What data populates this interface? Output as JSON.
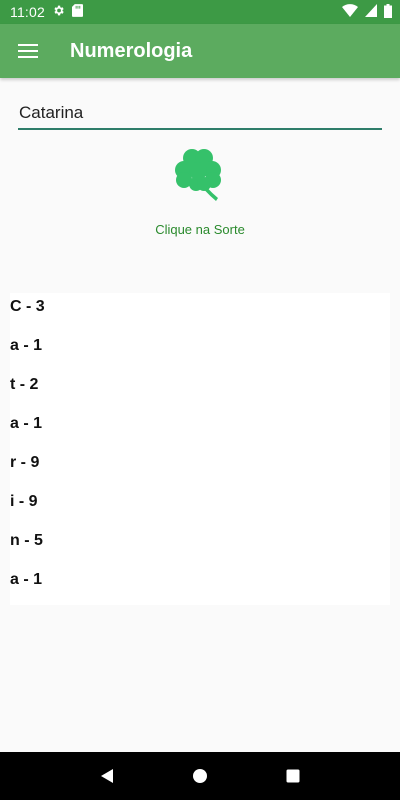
{
  "status_bar": {
    "time": "11:02",
    "icons": [
      "gear-icon",
      "sd-card-icon",
      "wifi-icon",
      "signal-icon",
      "battery-icon"
    ]
  },
  "app_bar": {
    "title": "Numerologia",
    "menu_icon": "hamburger-menu-icon"
  },
  "name_input": {
    "value": "Catarina"
  },
  "luck": {
    "icon": "clover-icon",
    "label": "Clique na Sorte"
  },
  "results": [
    "C - 3",
    "a - 1",
    "t - 2",
    "a - 1",
    "r - 9",
    "i - 9",
    "n - 5",
    "a - 1"
  ],
  "nav_bar": {
    "icons": [
      "back-icon",
      "home-icon",
      "recents-icon"
    ]
  },
  "colors": {
    "status_bar": "#3d9a45",
    "app_bar": "#5cab5f",
    "accent": "#2a8a2d",
    "clover": "#35c16a"
  }
}
